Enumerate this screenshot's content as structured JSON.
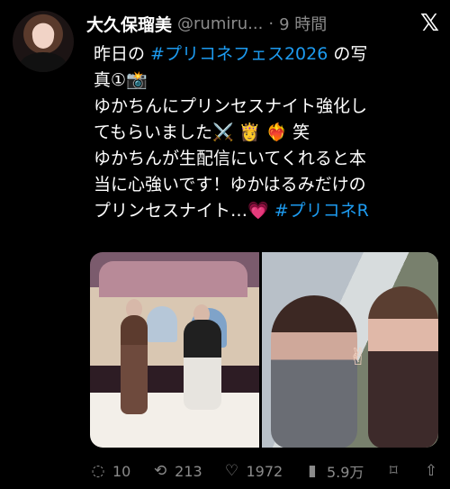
{
  "user": {
    "name": "大久保瑠美",
    "handle": "@rumiru...",
    "separator": "·",
    "time": "9 時間"
  },
  "tweet": {
    "lines": [
      {
        "parts": [
          "昨日の ",
          "#プリコネフェス2026",
          " の写"
        ]
      },
      {
        "parts": [
          "真①📸"
        ]
      },
      {
        "parts": [
          "ゆかちんにプリンセスナイト強化し"
        ]
      },
      {
        "parts": [
          "てもらいました⚔️ 👸 ❤️‍🔥 笑"
        ]
      },
      {
        "parts": [
          "ゆかちんが生配信にいてくれると本"
        ]
      },
      {
        "parts": [
          "当に心強いです！ゆかはるみだけの"
        ]
      },
      {
        "parts": [
          "プリンセスナイト…💗 ",
          "#プリコネR"
        ]
      }
    ]
  },
  "actions": {
    "reply": "10",
    "retweet": "213",
    "like": "1972",
    "views": "5.9万"
  },
  "icons": {
    "logo": "x-logo-icon",
    "reply": "reply-icon",
    "retweet": "retweet-icon",
    "like": "heart-icon",
    "views": "views-icon",
    "share": "share-icon"
  }
}
